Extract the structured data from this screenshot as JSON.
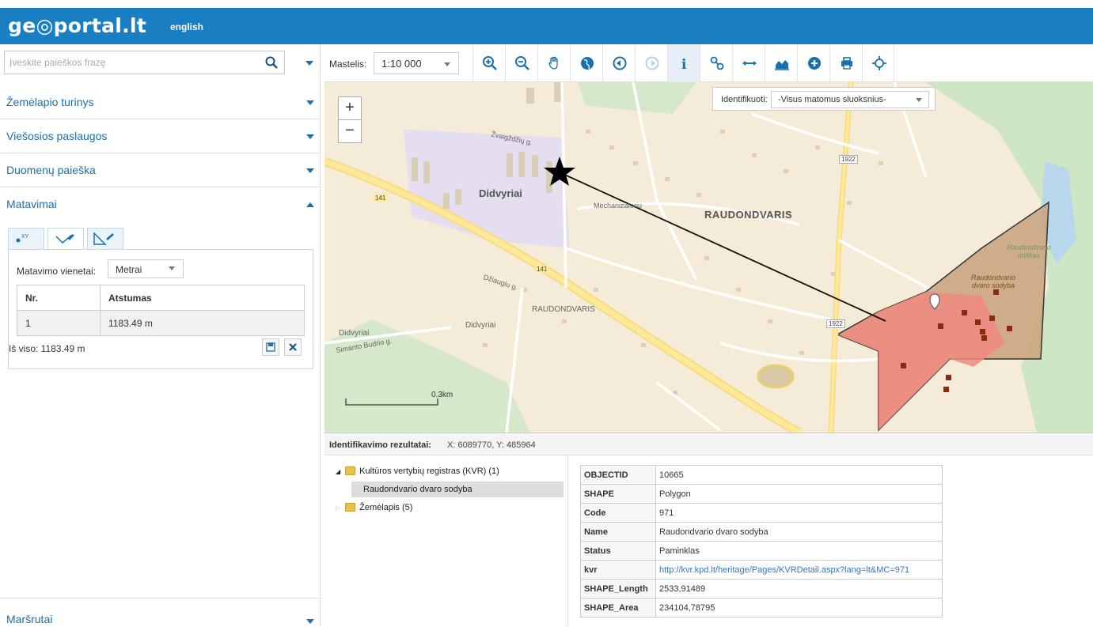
{
  "header": {
    "logo": "ge◎portal.lt",
    "lang": "english"
  },
  "search": {
    "placeholder": "Įveskite paieškos frazę",
    "value": ""
  },
  "sidebar": {
    "sections": [
      {
        "label": "Žemėlapio turinys"
      },
      {
        "label": "Viešosios paslaugos"
      },
      {
        "label": "Duomenų paieška"
      },
      {
        "label": "Matavimai"
      }
    ],
    "bottom": {
      "label": "Maršrutai"
    }
  },
  "measure": {
    "units_label": "Matavimo vienetai:",
    "units_value": "Metrai",
    "columns": [
      "Nr.",
      "Atstumas"
    ],
    "rows": [
      {
        "nr": "1",
        "distance": "1183.49 m"
      }
    ],
    "total": "Iš viso: 1183.49 m"
  },
  "toolbar": {
    "scale_label": "Mastelis:",
    "scale_value": "1:10 000"
  },
  "map": {
    "identify_label": "Identifikuoti:",
    "identify_value": "-Visus matomus sluoksnius-",
    "scale_bar": "0.3km",
    "labels": {
      "didvyriai": "Didvyriai",
      "raudondvaris": "RAUDONDVARIS",
      "raudondvaris_small": "RAUDONDVARIS",
      "didvyriai2": "Didvyriai",
      "didvyriai3": "Didvyriai",
      "zvaigzdziu": "Žvaigždžių g.",
      "mechanizatoriu": "Mechanizatorių",
      "dziaugiu": "Džiaugiu g.",
      "budrio": "Simanto Budrio g.",
      "road141a": "141",
      "road141b": "141",
      "road1922a": "1922",
      "road1922b": "1922",
      "milkas": "Raudondvario miškas",
      "sodyba": "Raudondvario dvaro sodyba"
    }
  },
  "results": {
    "title": "Identifikavimo rezultatai:",
    "coords": "X: 6089770, Y: 485964",
    "tree": [
      {
        "label": "Kultūros vertybių registras (KVR) (1)"
      },
      {
        "label": "Raudondvario dvaro sodyba"
      },
      {
        "label": "Žemėlapis (5)"
      }
    ],
    "attributes": [
      {
        "key": "OBJECTID",
        "value": "10665"
      },
      {
        "key": "SHAPE",
        "value": "Polygon"
      },
      {
        "key": "Code",
        "value": "971"
      },
      {
        "key": "Name",
        "value": "Raudondvario dvaro sodyba"
      },
      {
        "key": "Status",
        "value": "Paminklas"
      },
      {
        "key": "kvr",
        "value": "http://kvr.kpd.lt/heritage/Pages/KVRDetail.aspx?lang=lt&MC=971"
      },
      {
        "key": "SHAPE_Length",
        "value": "2533,91489"
      },
      {
        "key": "SHAPE_Area",
        "value": "234104,78795"
      }
    ]
  },
  "colors": {
    "header": "#1a7ec2",
    "accent": "#1a6fb0",
    "polygon": "#f08a80"
  },
  "icons": [
    "search-icon",
    "zoom-in-icon",
    "zoom-out-icon",
    "pan-hand-icon",
    "globe-icon",
    "previous-extent-icon",
    "next-extent-icon",
    "info-icon",
    "link-icon",
    "measure-distance-icon",
    "elevation-profile-icon",
    "add-icon",
    "print-icon",
    "locate-icon"
  ]
}
